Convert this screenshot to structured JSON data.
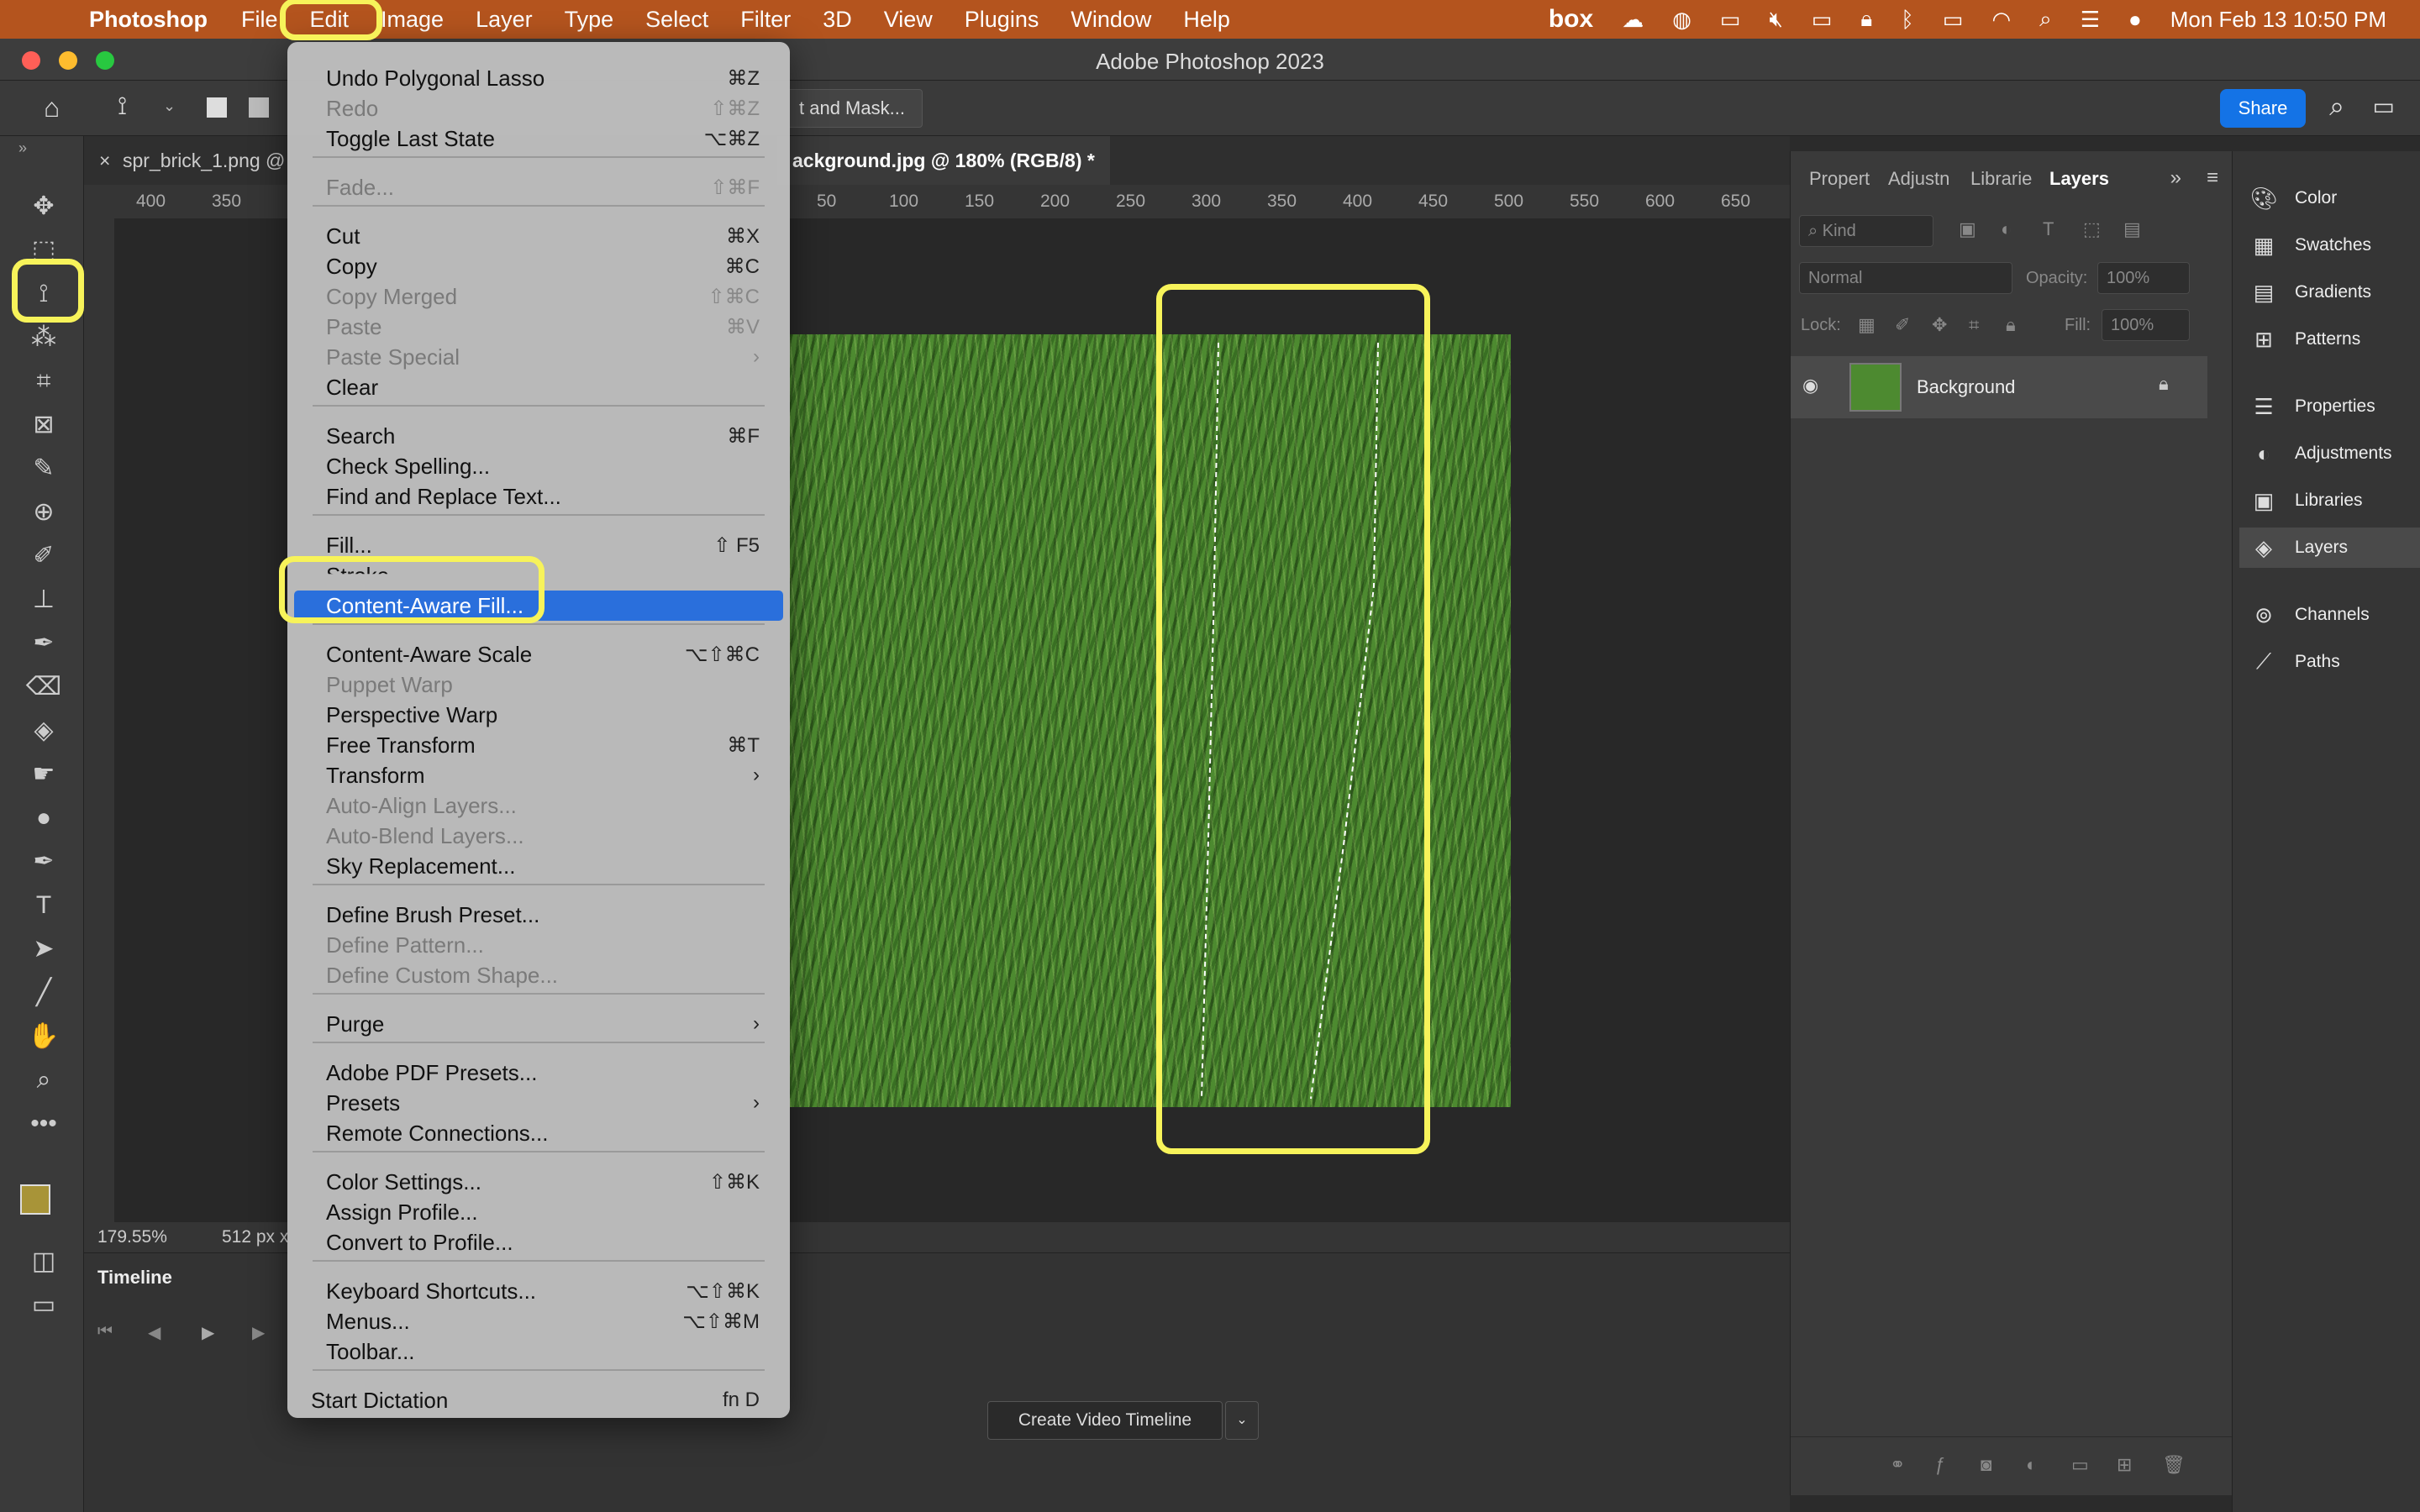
{
  "menubar": {
    "app": "Photoshop",
    "items": [
      "File",
      "Edit",
      "Image",
      "Layer",
      "Type",
      "Select",
      "Filter",
      "3D",
      "View",
      "Plugins",
      "Window",
      "Help"
    ],
    "clock": "Mon Feb 13  10:50 PM",
    "box": "box"
  },
  "window": {
    "title": "Adobe Photoshop 2023"
  },
  "options": {
    "share": "Share",
    "select_mask": "t and Mask..."
  },
  "doc": {
    "tabs": [
      "spr_brick_1.png @",
      "ackground.jpg @ 180% (RGB/8) *"
    ],
    "ruler_ticks": [
      "400",
      "350",
      "50",
      "100",
      "150",
      "200",
      "250",
      "300",
      "350",
      "400",
      "450",
      "500",
      "550",
      "600",
      "650"
    ],
    "zoom": "179.55%",
    "size": "512 px x"
  },
  "timeline": {
    "title": "Timeline",
    "create_button": "Create Video Timeline"
  },
  "layers_panel": {
    "tabs": [
      "Propert",
      "Adjustn",
      "Librarie",
      "Layers"
    ],
    "kind": "Kind",
    "blend_mode": "Normal",
    "opacity_label": "Opacity:",
    "opacity": "100%",
    "lock_label": "Lock:",
    "fill_label": "Fill:",
    "fill": "100%",
    "layer_name": "Background"
  },
  "dock": {
    "items": [
      "Color",
      "Swatches",
      "Gradients",
      "Patterns",
      "Properties",
      "Adjustments",
      "Libraries",
      "Layers",
      "Channels",
      "Paths"
    ]
  },
  "edit_menu": {
    "items": [
      {
        "label": "Undo Polygonal Lasso",
        "shortcut": "⌘Z",
        "disabled": false
      },
      {
        "label": "Redo",
        "shortcut": "⇧⌘Z",
        "disabled": true
      },
      {
        "label": "Toggle Last State",
        "shortcut": "⌥⌘Z",
        "disabled": false
      },
      {
        "label": "Fade...",
        "shortcut": "⇧⌘F",
        "disabled": true
      },
      {
        "label": "Cut",
        "shortcut": "⌘X",
        "disabled": false
      },
      {
        "label": "Copy",
        "shortcut": "⌘C",
        "disabled": false
      },
      {
        "label": "Copy Merged",
        "shortcut": "⇧⌘C",
        "disabled": true
      },
      {
        "label": "Paste",
        "shortcut": "⌘V",
        "disabled": true
      },
      {
        "label": "Paste Special",
        "shortcut": "›",
        "disabled": true
      },
      {
        "label": "Clear",
        "shortcut": "",
        "disabled": false
      },
      {
        "label": "Search",
        "shortcut": "⌘F",
        "disabled": false
      },
      {
        "label": "Check Spelling...",
        "shortcut": "",
        "disabled": false
      },
      {
        "label": "Find and Replace Text...",
        "shortcut": "",
        "disabled": false
      },
      {
        "label": "Fill...",
        "shortcut": "⇧ F5",
        "disabled": false
      },
      {
        "label": "Stroke...",
        "shortcut": "",
        "disabled": false
      },
      {
        "label": "Content-Aware Fill...",
        "shortcut": "",
        "disabled": false,
        "highlighted": true
      },
      {
        "label": "Content-Aware Scale",
        "shortcut": "⌥⇧⌘C",
        "disabled": false
      },
      {
        "label": "Puppet Warp",
        "shortcut": "",
        "disabled": true
      },
      {
        "label": "Perspective Warp",
        "shortcut": "",
        "disabled": false
      },
      {
        "label": "Free Transform",
        "shortcut": "⌘T",
        "disabled": false
      },
      {
        "label": "Transform",
        "shortcut": "›",
        "disabled": false
      },
      {
        "label": "Auto-Align Layers...",
        "shortcut": "",
        "disabled": true
      },
      {
        "label": "Auto-Blend Layers...",
        "shortcut": "",
        "disabled": true
      },
      {
        "label": "Sky Replacement...",
        "shortcut": "",
        "disabled": false
      },
      {
        "label": "Define Brush Preset...",
        "shortcut": "",
        "disabled": false
      },
      {
        "label": "Define Pattern...",
        "shortcut": "",
        "disabled": true
      },
      {
        "label": "Define Custom Shape...",
        "shortcut": "",
        "disabled": true
      },
      {
        "label": "Purge",
        "shortcut": "›",
        "disabled": false
      },
      {
        "label": "Adobe PDF Presets...",
        "shortcut": "",
        "disabled": false
      },
      {
        "label": "Presets",
        "shortcut": "›",
        "disabled": false
      },
      {
        "label": "Remote Connections...",
        "shortcut": "",
        "disabled": false
      },
      {
        "label": "Color Settings...",
        "shortcut": "⇧⌘K",
        "disabled": false
      },
      {
        "label": "Assign Profile...",
        "shortcut": "",
        "disabled": false
      },
      {
        "label": "Convert to Profile...",
        "shortcut": "",
        "disabled": false
      },
      {
        "label": "Keyboard Shortcuts...",
        "shortcut": "⌥⇧⌘K",
        "disabled": false
      },
      {
        "label": "Menus...",
        "shortcut": "⌥⇧⌘M",
        "disabled": false
      },
      {
        "label": "Toolbar...",
        "shortcut": "",
        "disabled": false
      },
      {
        "label": "Start Dictation",
        "shortcut": "fn D",
        "disabled": false
      }
    ]
  },
  "colors": {
    "menubar": "#b4541e",
    "highlight": "#2a6fdc",
    "annotation": "#f7f35a",
    "foreground_swatch": "#a89438"
  }
}
